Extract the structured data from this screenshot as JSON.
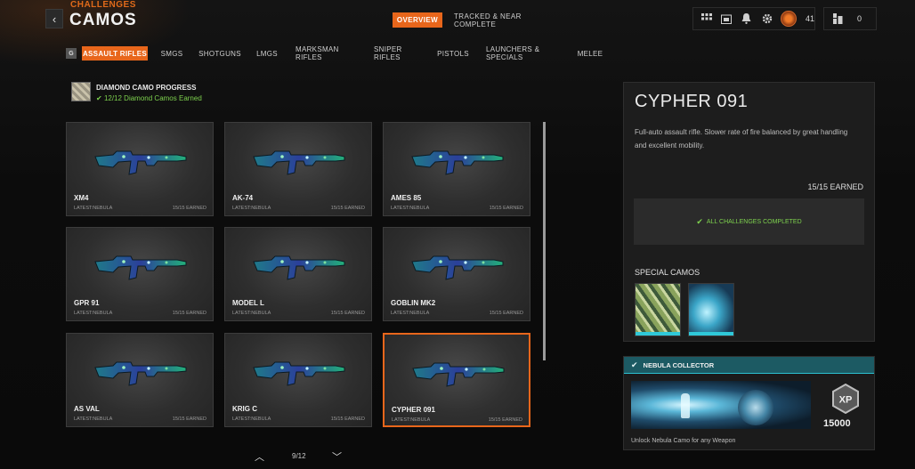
{
  "header": {
    "back_label": "‹",
    "breadcrumb": "CHALLENGES",
    "title": "CAMOS",
    "tabs": [
      {
        "label": "OVERVIEW",
        "active": true
      },
      {
        "label": "TRACKED & NEAR COMPLETE",
        "active": false
      }
    ],
    "tray": {
      "icons": [
        "grid-icon",
        "calendar-icon",
        "bell-icon",
        "gear-icon",
        "rank-icon"
      ],
      "rank_level": "41",
      "friends_count": "0"
    }
  },
  "categories": {
    "key_hint": "G",
    "items": [
      {
        "label": "ASSAULT RIFLES",
        "active": true
      },
      {
        "label": "SMGS",
        "active": false
      },
      {
        "label": "SHOTGUNS",
        "active": false
      },
      {
        "label": "LMGS",
        "active": false
      },
      {
        "label": "MARKSMAN RIFLES",
        "active": false
      },
      {
        "label": "SNIPER RIFLES",
        "active": false
      },
      {
        "label": "PISTOLS",
        "active": false
      },
      {
        "label": "LAUNCHERS & SPECIALS",
        "active": false
      },
      {
        "label": "MELEE",
        "active": false
      }
    ]
  },
  "progress": {
    "title": "DIAMOND CAMO PROGRESS",
    "subtitle": "12/12 Diamond Camos Earned"
  },
  "weapons": [
    {
      "name": "XM4",
      "latest": "LATEST:NEBULA",
      "earned": "15/15 EARNED"
    },
    {
      "name": "AK-74",
      "latest": "LATEST:NEBULA",
      "earned": "15/15 EARNED"
    },
    {
      "name": "AMES 85",
      "latest": "LATEST:NEBULA",
      "earned": "15/15 EARNED"
    },
    {
      "name": "GPR 91",
      "latest": "LATEST:NEBULA",
      "earned": "15/15 EARNED"
    },
    {
      "name": "MODEL L",
      "latest": "LATEST:NEBULA",
      "earned": "15/15 EARNED"
    },
    {
      "name": "GOBLIN MK2",
      "latest": "LATEST:NEBULA",
      "earned": "15/15 EARNED"
    },
    {
      "name": "AS VAL",
      "latest": "LATEST:NEBULA",
      "earned": "15/15 EARNED"
    },
    {
      "name": "KRIG C",
      "latest": "LATEST:NEBULA",
      "earned": "15/15 EARNED"
    },
    {
      "name": "CYPHER 091",
      "latest": "LATEST:NEBULA",
      "earned": "15/15 EARNED",
      "selected": true
    }
  ],
  "pager": {
    "text": "9/12"
  },
  "detail": {
    "title": "CYPHER 091",
    "description": "Full-auto assault rifle. Slower rate of fire balanced by great handling and excellent mobility.",
    "earned": "15/15 EARNED",
    "complete_text": "ALL CHALLENGES COMPLETED",
    "special_camos_label": "SPECIAL CAMOS"
  },
  "nebula": {
    "title": "NEBULA COLLECTOR",
    "xp_value": "15000",
    "description": "Unlock Nebula Camo for any Weapon"
  },
  "colors": {
    "accent": "#e8661b",
    "success": "#7ed24e",
    "teal": "#2cc0d0"
  }
}
